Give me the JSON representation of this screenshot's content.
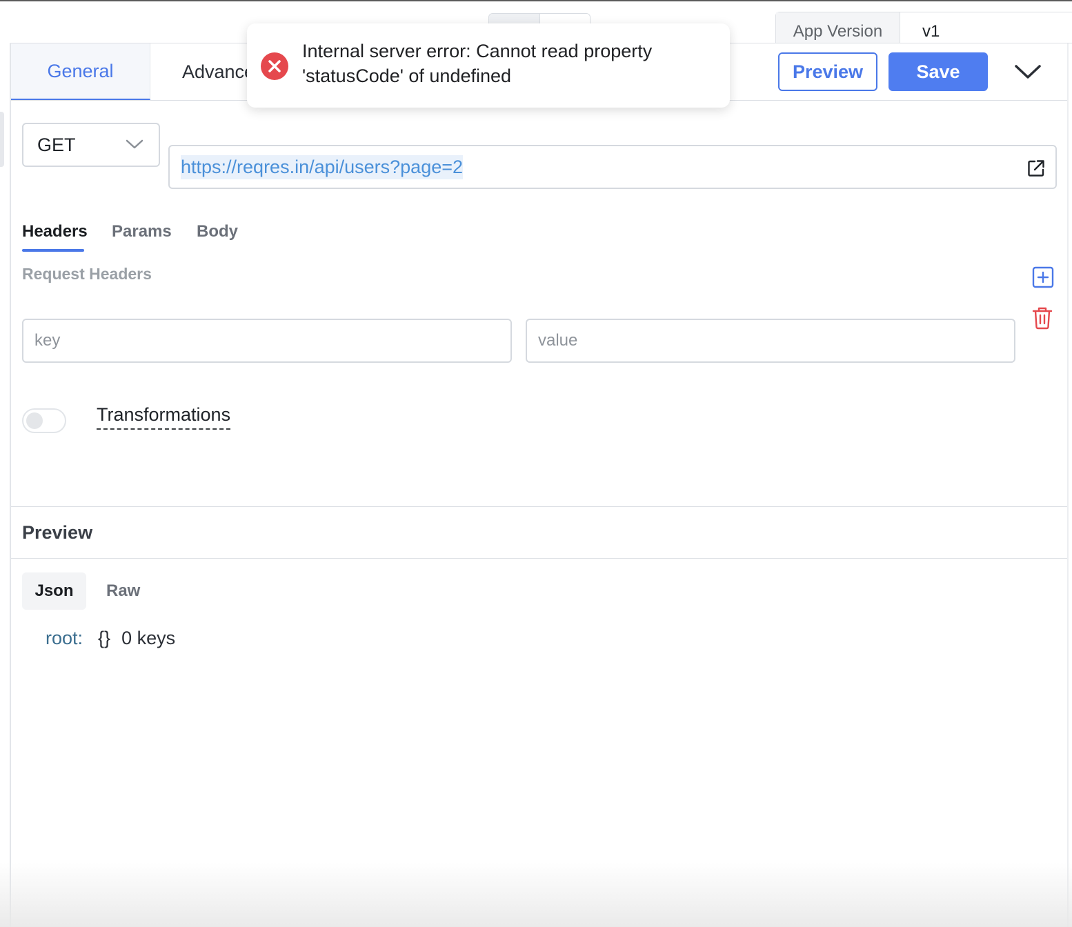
{
  "app_version": {
    "label": "App Version",
    "value": "v1"
  },
  "tabs": [
    {
      "label": "General",
      "active": true
    },
    {
      "label": "Advanced",
      "active": false
    }
  ],
  "actions": {
    "preview_label": "Preview",
    "save_label": "Save",
    "chevron_icon": "chevron-down-icon"
  },
  "toast": {
    "type": "error",
    "icon": "error-circle-icon",
    "message_line1": "Internal server error: Cannot read property",
    "message_line2": "'statusCode' of undefined"
  },
  "request": {
    "method": "GET",
    "url": "https://reqres.in/api/users?page=2",
    "open_icon": "external-link-icon"
  },
  "request_tabs": [
    {
      "label": "Headers",
      "active": true
    },
    {
      "label": "Params",
      "active": false
    },
    {
      "label": "Body",
      "active": false
    }
  ],
  "headers_section": {
    "title": "Request Headers",
    "key_placeholder": "key",
    "value_placeholder": "value",
    "add_icon": "add-square-icon",
    "delete_icon": "trash-icon"
  },
  "transformations": {
    "label": "Transformations",
    "enabled": false
  },
  "preview": {
    "title": "Preview",
    "tabs": [
      {
        "label": "Json",
        "active": true
      },
      {
        "label": "Raw",
        "active": false
      }
    ],
    "json": {
      "root_key": "root:",
      "brace": "{}",
      "summary": "0 keys"
    }
  },
  "colors": {
    "accent": "#4f7df0",
    "error": "#e5484d",
    "danger_icon": "#e5484d",
    "url_text": "#4a90d9"
  }
}
